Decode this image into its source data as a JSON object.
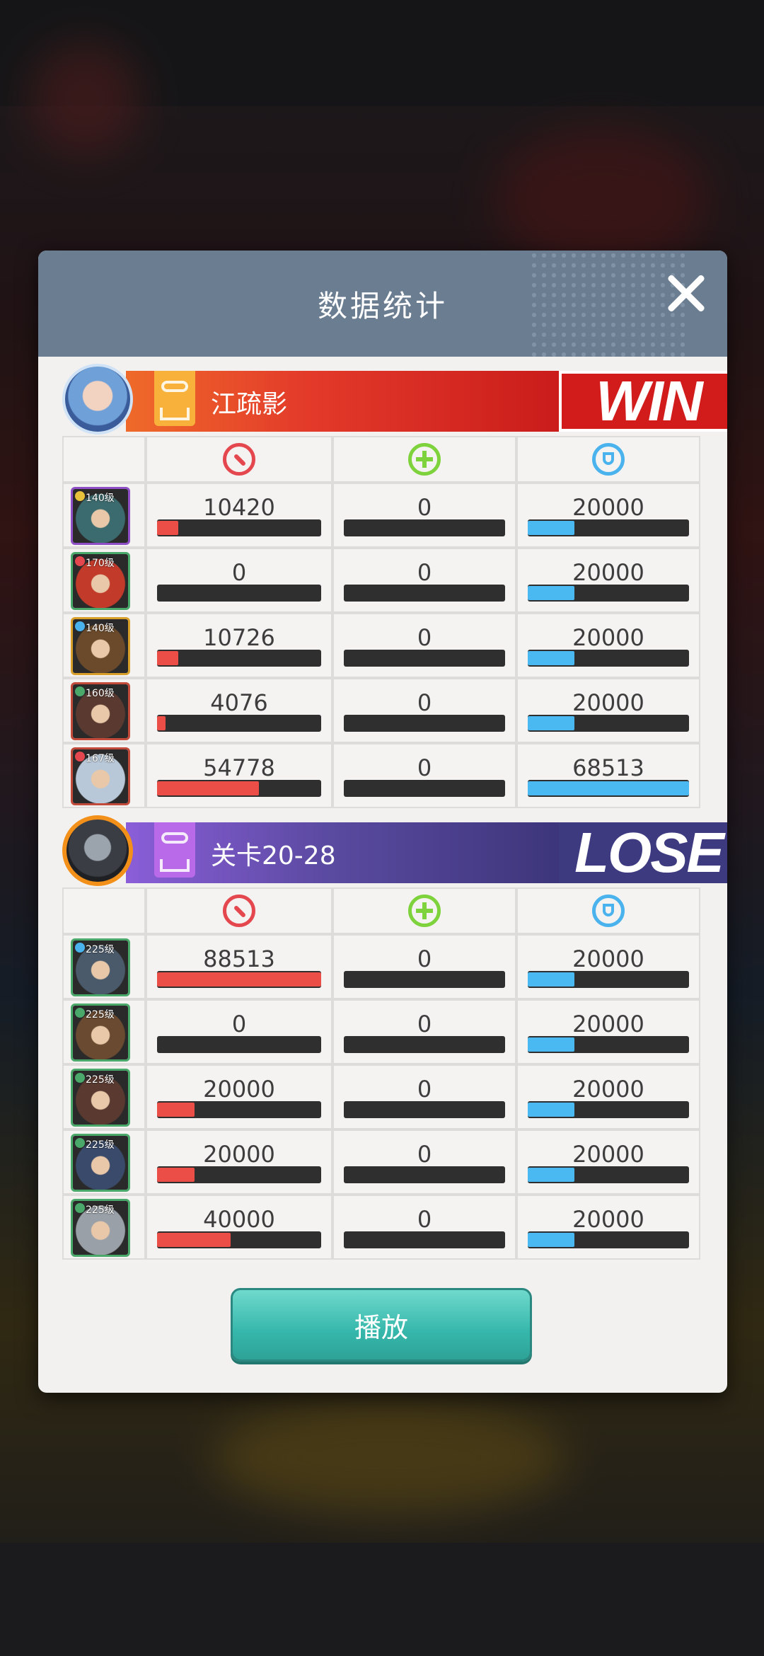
{
  "modal": {
    "title": "数据统计"
  },
  "teams": [
    {
      "name": "江疏影",
      "result": "WIN",
      "heroes": [
        {
          "level": "140级",
          "attack": "10420",
          "heal": "0",
          "defense": "20000",
          "attack_pct": 0.13,
          "heal_pct": 0,
          "defense_pct": 0.29,
          "frame": "#8e4fc6",
          "dot": "#e8c23a",
          "skin": "#3b6b6e"
        },
        {
          "level": "170级",
          "attack": "0",
          "heal": "0",
          "defense": "20000",
          "attack_pct": 0,
          "heal_pct": 0,
          "defense_pct": 0.29,
          "frame": "#4aa86a",
          "dot": "#e5474f",
          "skin": "#c23a2a"
        },
        {
          "level": "140级",
          "attack": "10726",
          "heal": "0",
          "defense": "20000",
          "attack_pct": 0.13,
          "heal_pct": 0,
          "defense_pct": 0.29,
          "frame": "#d8a02a",
          "dot": "#4ab3ee",
          "skin": "#6a4a2a"
        },
        {
          "level": "160级",
          "attack": "4076",
          "heal": "0",
          "defense": "20000",
          "attack_pct": 0.05,
          "heal_pct": 0,
          "defense_pct": 0.29,
          "frame": "#c24a3a",
          "dot": "#4aa86a",
          "skin": "#5a3a30"
        },
        {
          "level": "167级",
          "attack": "54778",
          "heal": "0",
          "defense": "68513",
          "attack_pct": 0.62,
          "heal_pct": 0,
          "defense_pct": 1.0,
          "frame": "#c24a3a",
          "dot": "#e5474f",
          "skin": "#b8c8d8"
        }
      ]
    },
    {
      "name": "关卡20-28",
      "result": "LOSE",
      "heroes": [
        {
          "level": "225级",
          "attack": "88513",
          "heal": "0",
          "defense": "20000",
          "attack_pct": 1.0,
          "heal_pct": 0,
          "defense_pct": 0.29,
          "frame": "#4aa86a",
          "dot": "#4ab3ee",
          "skin": "#4a5a6a"
        },
        {
          "level": "225级",
          "attack": "0",
          "heal": "0",
          "defense": "20000",
          "attack_pct": 0,
          "heal_pct": 0,
          "defense_pct": 0.29,
          "frame": "#4aa86a",
          "dot": "#4aa86a",
          "skin": "#6a4a30"
        },
        {
          "level": "225级",
          "attack": "20000",
          "heal": "0",
          "defense": "20000",
          "attack_pct": 0.23,
          "heal_pct": 0,
          "defense_pct": 0.29,
          "frame": "#4aa86a",
          "dot": "#4aa86a",
          "skin": "#5a3a30"
        },
        {
          "level": "225级",
          "attack": "20000",
          "heal": "0",
          "defense": "20000",
          "attack_pct": 0.23,
          "heal_pct": 0,
          "defense_pct": 0.29,
          "frame": "#4aa86a",
          "dot": "#4aa86a",
          "skin": "#3a4a6a"
        },
        {
          "level": "225级",
          "attack": "40000",
          "heal": "0",
          "defense": "20000",
          "attack_pct": 0.45,
          "heal_pct": 0,
          "defense_pct": 0.29,
          "frame": "#4aa86a",
          "dot": "#4aa86a",
          "skin": "#9aa0a8"
        }
      ]
    }
  ],
  "play_button": {
    "label": "播放"
  },
  "colors": {
    "header": "#6b7d91",
    "win": "#d21c1c",
    "lose": "#3d3a80",
    "attack_bar": "#ea4e47",
    "defense_bar": "#4ab9f2",
    "play": "#36b7ab"
  }
}
